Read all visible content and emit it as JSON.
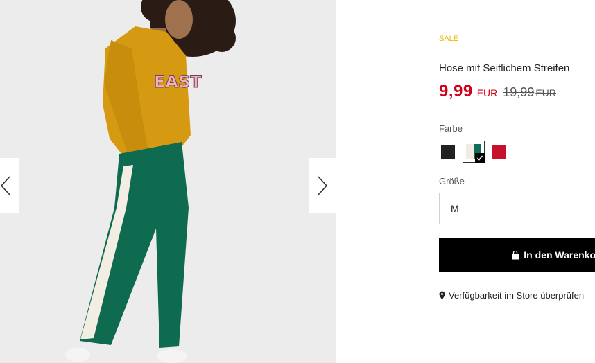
{
  "product": {
    "badge": "SALE",
    "title": "Hose mit Seitlichem Streifen",
    "price_now": "9,99",
    "currency_now": "EUR",
    "price_old": "19,99",
    "currency_old": "EUR"
  },
  "colors": {
    "label": "Farbe",
    "swatches": [
      {
        "name": "black",
        "hex": "#222222",
        "selected": false
      },
      {
        "name": "green-white",
        "hex": "#0f6b5a",
        "selected": true
      },
      {
        "name": "red",
        "hex": "#c8102e",
        "selected": false
      }
    ]
  },
  "size": {
    "label": "Größe",
    "selected": "M"
  },
  "cart": {
    "label": "In den Warenkorb"
  },
  "store": {
    "label": "Verfügbarkeit im Store überprüfen"
  },
  "gallery": {
    "sweater_text": "EAST"
  },
  "colors_theme": {
    "accent": "#e6b800",
    "price": "#d0021b"
  }
}
